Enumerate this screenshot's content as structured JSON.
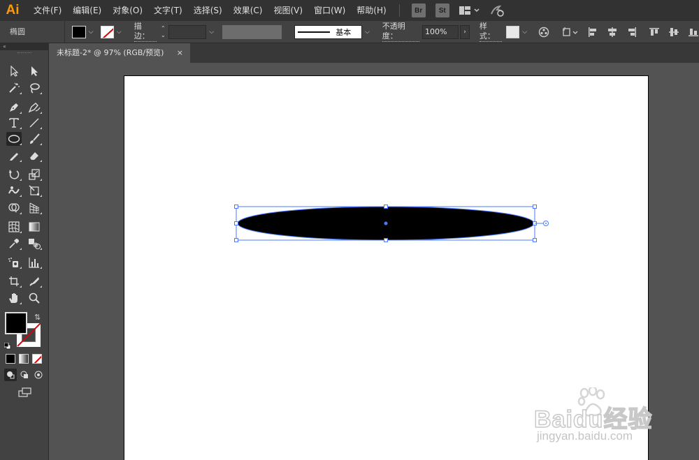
{
  "app": {
    "logo": "Ai"
  },
  "menu": [
    "文件(F)",
    "编辑(E)",
    "对象(O)",
    "文字(T)",
    "选择(S)",
    "效果(C)",
    "视图(V)",
    "窗口(W)",
    "帮助(H)"
  ],
  "menubar_buttons": {
    "bridge": "Br",
    "stock": "St"
  },
  "control": {
    "object_type": "椭圆",
    "stroke_label": "描边：",
    "brush_label": "基本",
    "opacity_label": "不透明度：",
    "opacity_value": "100%",
    "style_label": "样式："
  },
  "document_tab": {
    "title": "未标题-2* @ 97% (RGB/预览)",
    "close": "×"
  },
  "watermark": {
    "brand": "Baidu经验",
    "url": "jingyan.baidu.com"
  },
  "colors": {
    "fill": "#000000",
    "stroke": "none",
    "selection": "#4a7bff",
    "accent": "#ff9a00"
  },
  "icons": {
    "tools": [
      "selection-icon",
      "direct-selection-icon",
      "magic-wand-icon",
      "lasso-icon",
      "pen-icon",
      "curvature-icon",
      "type-icon",
      "line-segment-icon",
      "ellipse-icon",
      "paintbrush-icon",
      "pencil-icon",
      "eraser-icon",
      "rotate-icon",
      "scale-icon",
      "warp-icon",
      "free-transform-icon",
      "shape-builder-icon",
      "perspective-grid-icon",
      "mesh-icon",
      "gradient-icon",
      "eyedropper-icon",
      "blend-icon",
      "symbol-sprayer-icon",
      "column-graph-icon",
      "artboard-icon",
      "slice-icon",
      "hand-icon",
      "zoom-icon"
    ]
  }
}
